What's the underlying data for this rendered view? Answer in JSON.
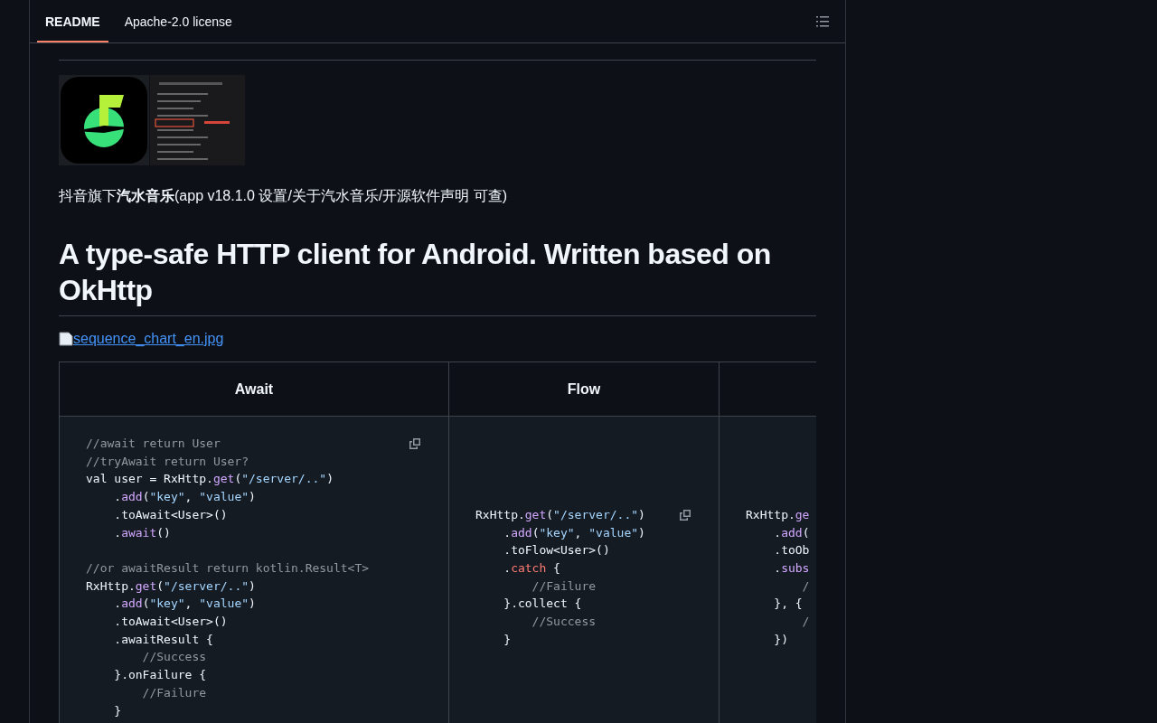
{
  "tabs": [
    {
      "label": "README",
      "selected": true
    },
    {
      "label": "Apache-2.0 license",
      "selected": false
    }
  ],
  "caption": "抖音旗下**汽水音乐**(app v18.1.0 设置/关于汽水音乐/开源软件声明 可查)",
  "heading": "A type-safe HTTP client for Android. Written based on OkHttp",
  "image_link": "sequence_chart_en.jpg",
  "table": {
    "columns": [
      "Await",
      "Flow",
      ""
    ],
    "cells": [
      {
        "blocks": [
          {
            "lines": [
              [
                {
                  "kind": "comment",
                  "text": "//await return User"
                }
              ],
              [
                {
                  "kind": "comment",
                  "text": "//tryAwait return User?"
                }
              ],
              [
                {
                  "kind": "plain",
                  "text": "val user = RxHttp."
                },
                {
                  "kind": "method",
                  "text": "get"
                },
                {
                  "kind": "plain",
                  "text": "("
                },
                {
                  "kind": "string",
                  "text": "\"/server/..\""
                },
                {
                  "kind": "plain",
                  "text": ")"
                }
              ],
              [
                {
                  "kind": "plain",
                  "text": "    ."
                },
                {
                  "kind": "method",
                  "text": "add"
                },
                {
                  "kind": "plain",
                  "text": "("
                },
                {
                  "kind": "string",
                  "text": "\"key\""
                },
                {
                  "kind": "plain",
                  "text": ", "
                },
                {
                  "kind": "string",
                  "text": "\"value\""
                },
                {
                  "kind": "plain",
                  "text": ")"
                }
              ],
              [
                {
                  "kind": "plain",
                  "text": "    .toAwait<User>()"
                }
              ],
              [
                {
                  "kind": "plain",
                  "text": "    ."
                },
                {
                  "kind": "method",
                  "text": "await"
                },
                {
                  "kind": "plain",
                  "text": "()"
                }
              ]
            ]
          },
          {
            "lines": [
              [
                {
                  "kind": "comment",
                  "text": "//or awaitResult return kotlin.Result<T>"
                }
              ],
              [
                {
                  "kind": "plain",
                  "text": "RxHttp."
                },
                {
                  "kind": "method",
                  "text": "get"
                },
                {
                  "kind": "plain",
                  "text": "("
                },
                {
                  "kind": "string",
                  "text": "\"/server/..\""
                },
                {
                  "kind": "plain",
                  "text": ")"
                }
              ],
              [
                {
                  "kind": "plain",
                  "text": "    ."
                },
                {
                  "kind": "method",
                  "text": "add"
                },
                {
                  "kind": "plain",
                  "text": "("
                },
                {
                  "kind": "string",
                  "text": "\"key\""
                },
                {
                  "kind": "plain",
                  "text": ", "
                },
                {
                  "kind": "string",
                  "text": "\"value\""
                },
                {
                  "kind": "plain",
                  "text": ")"
                }
              ],
              [
                {
                  "kind": "plain",
                  "text": "    .toAwait<User>()"
                }
              ],
              [
                {
                  "kind": "plain",
                  "text": "    .awaitResult {"
                }
              ],
              [
                {
                  "kind": "comment",
                  "text": "        //Success"
                }
              ],
              [
                {
                  "kind": "plain",
                  "text": "    }.onFailure {"
                }
              ],
              [
                {
                  "kind": "comment",
                  "text": "        //Failure"
                }
              ],
              [
                {
                  "kind": "plain",
                  "text": "    }"
                }
              ]
            ]
          }
        ],
        "copy": true
      },
      {
        "blocks": [
          {
            "lines": [
              [
                {
                  "kind": "plain",
                  "text": "RxHttp."
                },
                {
                  "kind": "method",
                  "text": "get"
                },
                {
                  "kind": "plain",
                  "text": "("
                },
                {
                  "kind": "string",
                  "text": "\"/server/..\""
                },
                {
                  "kind": "plain",
                  "text": ")"
                }
              ],
              [
                {
                  "kind": "plain",
                  "text": "    ."
                },
                {
                  "kind": "method",
                  "text": "add"
                },
                {
                  "kind": "plain",
                  "text": "("
                },
                {
                  "kind": "string",
                  "text": "\"key\""
                },
                {
                  "kind": "plain",
                  "text": ", "
                },
                {
                  "kind": "string",
                  "text": "\"value\""
                },
                {
                  "kind": "plain",
                  "text": ")"
                }
              ],
              [
                {
                  "kind": "plain",
                  "text": "    .toFlow<User>()"
                }
              ],
              [
                {
                  "kind": "plain",
                  "text": "    ."
                },
                {
                  "kind": "keyword",
                  "text": "catch"
                },
                {
                  "kind": "plain",
                  "text": " {"
                }
              ],
              [
                {
                  "kind": "comment",
                  "text": "        //Failure"
                }
              ],
              [
                {
                  "kind": "plain",
                  "text": "    }.collect {"
                }
              ],
              [
                {
                  "kind": "comment",
                  "text": "        //Success"
                }
              ],
              [
                {
                  "kind": "plain",
                  "text": "    }"
                }
              ]
            ]
          }
        ],
        "copy": true
      },
      {
        "blocks": [
          {
            "lines": [
              [
                {
                  "kind": "plain",
                  "text": "RxHttp."
                },
                {
                  "kind": "method",
                  "text": "ge"
                }
              ],
              [
                {
                  "kind": "plain",
                  "text": "    ."
                },
                {
                  "kind": "method",
                  "text": "add"
                },
                {
                  "kind": "plain",
                  "text": "("
                }
              ],
              [
                {
                  "kind": "plain",
                  "text": "    .toOb"
                }
              ],
              [
                {
                  "kind": "plain",
                  "text": "    ."
                },
                {
                  "kind": "method",
                  "text": "subs"
                }
              ],
              [
                {
                  "kind": "comment",
                  "text": "        /"
                }
              ],
              [
                {
                  "kind": "plain",
                  "text": "    }, {"
                }
              ],
              [
                {
                  "kind": "comment",
                  "text": "        /"
                }
              ],
              [
                {
                  "kind": "plain",
                  "text": "    })"
                }
              ]
            ]
          }
        ],
        "copy": false
      }
    ]
  }
}
